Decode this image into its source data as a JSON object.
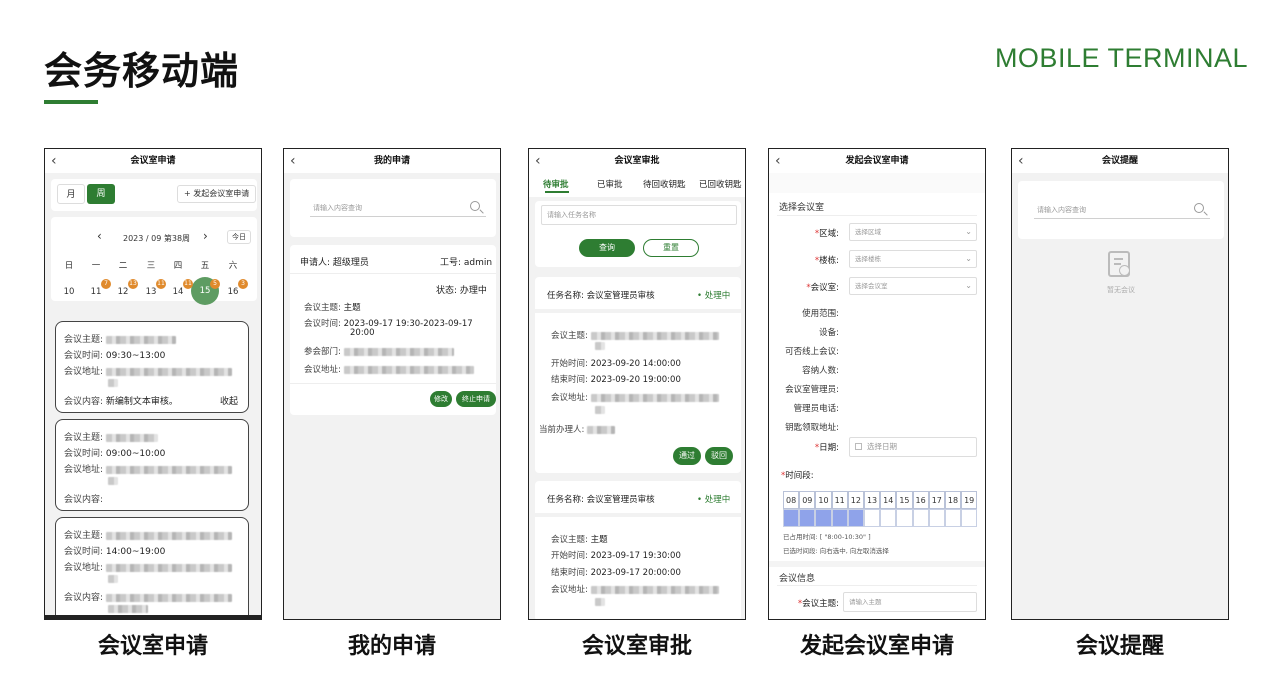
{
  "header": {
    "title": "会务移动端",
    "subtitle": "MOBILE TERMINAL"
  },
  "colors": {
    "accent": "#2e7d32",
    "badge": "#e08a2c",
    "time_selected": "#8fa3ea"
  },
  "captions": [
    "会议室申请",
    "我的申请",
    "会议室审批",
    "发起会议室申请",
    "会议提醒"
  ],
  "screen1": {
    "title": "会议室申请",
    "back_icon": "chevron-left-icon",
    "tab_month": "月",
    "tab_week": "周",
    "create_button": "+ 发起会议室申请",
    "prev": "‹",
    "next": "›",
    "week_label": "2023 / 09 第38周",
    "today_button": "今日",
    "weekdays": [
      "日",
      "一",
      "二",
      "三",
      "四",
      "五",
      "六"
    ],
    "dates": [
      "10",
      "11",
      "12",
      "13",
      "14",
      "15",
      "16"
    ],
    "badges": [
      "7",
      "13",
      "11",
      "11",
      "5",
      "3"
    ],
    "cards": [
      {
        "theme_label": "会议主题:",
        "time_label": "会议时间:",
        "time": "09:30~13:00",
        "addr_label": "会议地址:",
        "content_label": "会议内容:",
        "content": "新编制文本审核。",
        "collapse": "收起"
      },
      {
        "theme_label": "会议主题:",
        "time_label": "会议时间:",
        "time": "09:00~10:00",
        "addr_label": "会议地址:",
        "content_label": "会议内容:"
      },
      {
        "theme_label": "会议主题:",
        "time_label": "会议时间:",
        "time": "14:00~19:00",
        "addr_label": "会议地址:",
        "content_label": "会议内容:"
      }
    ]
  },
  "screen2": {
    "title": "我的申请",
    "search_placeholder": "请输入内容查询",
    "applicant_label": "申请人:",
    "applicant": "超级理员",
    "job_no_label": "工号:",
    "job_no": "admin",
    "status_label": "状态:",
    "status": "办理中",
    "theme_label": "会议主题:",
    "theme": "主题",
    "time_label": "会议时间:",
    "time": "2023-09-17 19:30-2023-09-17",
    "time_end": "20:00",
    "dept_label": "参会部门:",
    "addr_label": "会议地址:",
    "edit_button": "修改",
    "stop_button": "终止申请"
  },
  "screen3": {
    "title": "会议室审批",
    "tabs": [
      "待审批",
      "已审批",
      "待回收钥匙",
      "已回收钥匙"
    ],
    "search_placeholder": "请输入任务名称",
    "query_button": "查询",
    "reset_button": "重置",
    "task_label": "任务名称:",
    "task_name": "会议室管理员审核",
    "task_status": "• 处理中",
    "theme_label": "会议主题:",
    "start_label": "开始时间:",
    "end_label": "结束时间:",
    "addr_label": "会议地址:",
    "handler_label": "当前办理人:",
    "card1_start": "2023-09-20 14:00:00",
    "card1_end": "2023-09-20 19:00:00",
    "approve_button": "通过",
    "reject_button": "驳回",
    "card2_theme": "主题",
    "card2_start": "2023-09-17 19:30:00",
    "card2_end": "2023-09-17 20:00:00"
  },
  "screen4": {
    "title": "发起会议室申请",
    "section_room": "选择会议室",
    "area_label": "区域:",
    "area_placeholder": "选择区域",
    "building_label": "楼栋:",
    "building_placeholder": "选择楼栋",
    "room_label": "会议室:",
    "room_placeholder": "选择会议室",
    "info_labels": [
      "使用范围:",
      "设备:",
      "可否线上会议:",
      "容纳人数:",
      "会议室管理员:",
      "管理员电话:",
      "钥匙领取地址:"
    ],
    "date_label": "日期:",
    "date_placeholder": "选择日期",
    "timeslot_label": "时间段:",
    "hours": [
      "08",
      "09",
      "10",
      "11",
      "12",
      "13",
      "14",
      "15",
      "16",
      "17",
      "18",
      "19"
    ],
    "selected_slots": [
      0,
      1,
      2,
      3,
      4
    ],
    "occupied_text": "已占用时间: [ \"8:00-10:30\" ]",
    "hint_text": "已选时间段: 向右选中, 向左取消选择",
    "section_info": "会议信息",
    "topic_label": "会议主题:",
    "topic_placeholder": "请输入主题"
  },
  "screen5": {
    "title": "会议提醒",
    "search_placeholder": "请输入内容查询",
    "empty_text": "暂无会议"
  }
}
